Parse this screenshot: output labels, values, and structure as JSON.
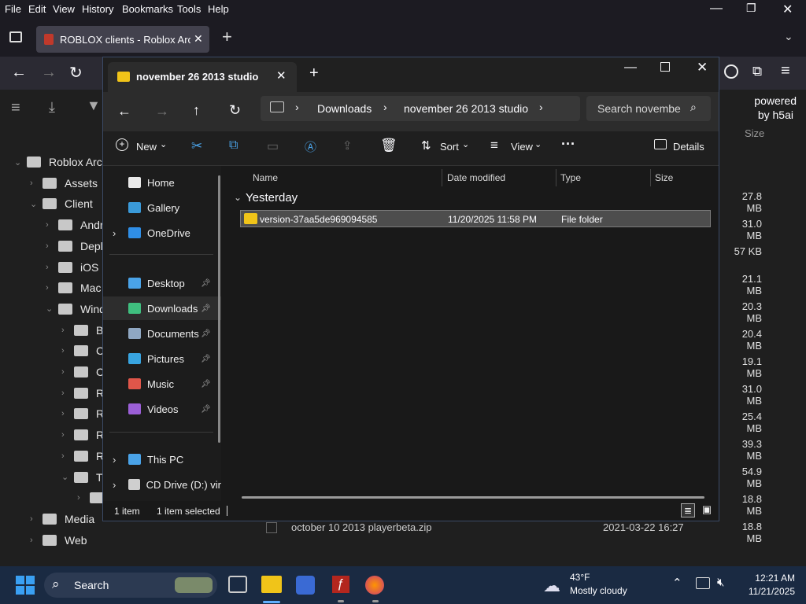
{
  "firefox": {
    "menu": [
      "File",
      "Edit",
      "View",
      "History",
      "Bookmarks",
      "Tools",
      "Help"
    ],
    "tab_title": "ROBLOX clients - Roblox Archiv",
    "page": {
      "powered_line1": "powered",
      "powered_line2": "by h5ai",
      "size_header": "Size",
      "tree": [
        {
          "label": "Roblox Arch",
          "indent": 0,
          "expanded": true
        },
        {
          "label": "Assets",
          "indent": 1,
          "expanded": false
        },
        {
          "label": "Client",
          "indent": 1,
          "expanded": true
        },
        {
          "label": "Andr",
          "indent": 2,
          "expanded": false
        },
        {
          "label": "Depl",
          "indent": 2,
          "expanded": false
        },
        {
          "label": "iOS",
          "indent": 2,
          "expanded": false
        },
        {
          "label": "Mac",
          "indent": 2,
          "expanded": false
        },
        {
          "label": "Wind",
          "indent": 2,
          "expanded": true
        },
        {
          "label": "B",
          "indent": 3,
          "expanded": false
        },
        {
          "label": "C",
          "indent": 3,
          "expanded": false
        },
        {
          "label": "C",
          "indent": 3,
          "expanded": false
        },
        {
          "label": "R",
          "indent": 3,
          "expanded": false
        },
        {
          "label": "R",
          "indent": 3,
          "expanded": false
        },
        {
          "label": "R",
          "indent": 3,
          "expanded": false
        },
        {
          "label": "R",
          "indent": 3,
          "expanded": false
        },
        {
          "label": "T",
          "indent": 3,
          "expanded": true
        },
        {
          "label": "",
          "indent": 4,
          "expanded": false
        },
        {
          "label": "Media",
          "indent": 1,
          "expanded": false
        },
        {
          "label": "Web",
          "indent": 1,
          "expanded": false
        }
      ],
      "sizes": [
        "27.8 MB",
        "31.0 MB",
        "57 KB",
        "21.1 MB",
        "20.3 MB",
        "20.4 MB",
        "19.1 MB",
        "31.0 MB",
        "25.4 MB",
        "39.3 MB",
        "54.9 MB",
        "18.8 MB",
        "18.8 MB"
      ],
      "bottom_file": {
        "name": "october 10 2013 playerbeta.zip",
        "date": "2021-03-22 16:27"
      }
    }
  },
  "explorer": {
    "tab_title": "november 26 2013 studio",
    "breadcrumb": [
      "Downloads",
      "november 26 2013 studio"
    ],
    "search_placeholder": "Search novembe",
    "commands": {
      "new": "New",
      "sort": "Sort",
      "view": "View",
      "details": "Details"
    },
    "sidebar": [
      {
        "label": "Home",
        "icon": "home-icon",
        "color": "#e8e8e8",
        "pinned": false,
        "expander": false
      },
      {
        "label": "Gallery",
        "icon": "gallery-icon",
        "color": "#3a9ad9",
        "pinned": false,
        "expander": false
      },
      {
        "label": "OneDrive",
        "icon": "onedrive-icon",
        "color": "#2f8ee6",
        "pinned": false,
        "expander": true
      },
      {
        "label": "Desktop",
        "icon": "desktop-icon",
        "color": "#4aa3e8",
        "pinned": true,
        "expander": false
      },
      {
        "label": "Downloads",
        "icon": "downloads-icon",
        "color": "#3fbf7f",
        "pinned": true,
        "expander": false
      },
      {
        "label": "Documents",
        "icon": "documents-icon",
        "color": "#8fa7c2",
        "pinned": true,
        "expander": false
      },
      {
        "label": "Pictures",
        "icon": "pictures-icon",
        "color": "#38a4e0",
        "pinned": true,
        "expander": false
      },
      {
        "label": "Music",
        "icon": "music-icon",
        "color": "#e0564a",
        "pinned": true,
        "expander": false
      },
      {
        "label": "Videos",
        "icon": "videos-icon",
        "color": "#9b5fd6",
        "pinned": true,
        "expander": false
      },
      {
        "label": "This PC",
        "icon": "this-pc-icon",
        "color": "#4aa3e8",
        "pinned": false,
        "expander": true
      },
      {
        "label": "CD Drive (D:) vir",
        "icon": "cd-drive-icon",
        "color": "#cfcfcf",
        "pinned": false,
        "expander": true
      }
    ],
    "columns": [
      "Name",
      "Date modified",
      "Type",
      "Size"
    ],
    "group": "Yesterday",
    "rows": [
      {
        "name": "version-37aa5de969094585",
        "date": "11/20/2025 11:58 PM",
        "type": "File folder",
        "size": ""
      }
    ],
    "status": {
      "count": "1 item",
      "selected": "1 item selected"
    }
  },
  "taskbar": {
    "search_label": "Search",
    "weather_temp": "43°F",
    "weather_desc": "Mostly cloudy",
    "time": "12:21 AM",
    "date": "11/21/2025"
  },
  "colors": {
    "accent": "#0078d4",
    "selection": "#4d4d4d",
    "folder": "#f0c419"
  }
}
